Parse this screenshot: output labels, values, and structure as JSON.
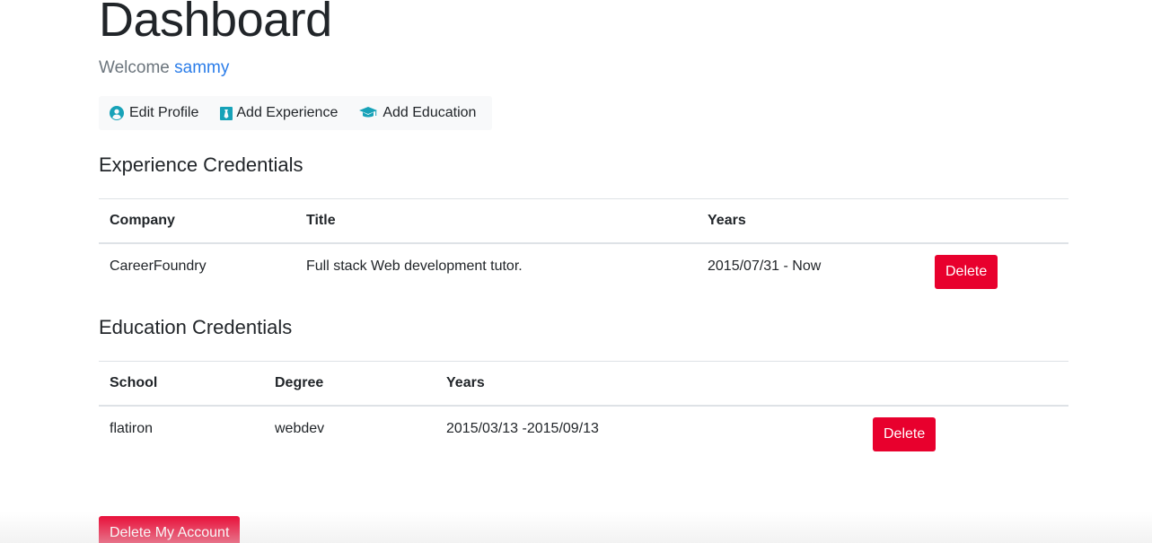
{
  "header": {
    "title": "Dashboard",
    "welcome_prefix": "Welcome ",
    "username": "sammy"
  },
  "actions": [
    {
      "label": "Edit Profile",
      "icon": "user-circle-icon"
    },
    {
      "label": "Add Experience",
      "icon": "black-tie-icon"
    },
    {
      "label": "Add Education",
      "icon": "graduation-cap-icon"
    }
  ],
  "experience": {
    "title": "Experience Credentials",
    "headers": [
      "Company",
      "Title",
      "Years"
    ],
    "rows": [
      {
        "company": "CareerFoundry",
        "title": "Full stack Web development tutor.",
        "years": "2015/07/31 - Now",
        "action": "Delete"
      }
    ]
  },
  "education": {
    "title": "Education Credentials",
    "headers": [
      "School",
      "Degree",
      "Years"
    ],
    "rows": [
      {
        "school": "flatiron",
        "degree": "webdev",
        "years": "2015/03/13 -2015/09/13",
        "action": "Delete"
      }
    ]
  },
  "delete_account_label": "Delete My Account",
  "colors": {
    "accent_icon": "#17a2b8",
    "danger": "#e8002d",
    "link": "#2b7de9"
  }
}
